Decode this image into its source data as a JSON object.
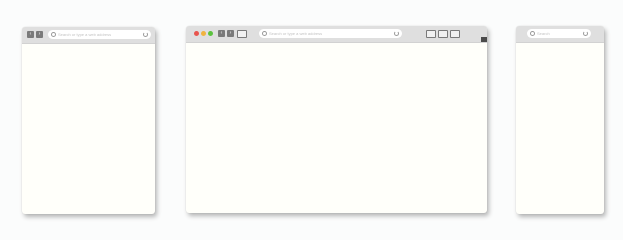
{
  "windows": {
    "tablet": {
      "back": "‹",
      "forward": "›",
      "url_placeholder": "Search or type a web address",
      "search_icon": "search-icon",
      "reload_icon": "reload-icon"
    },
    "desktop": {
      "traffic_lights": {
        "close": "#e8554e",
        "minimize": "#f0b33f",
        "maximize": "#5bc23e"
      },
      "back": "‹",
      "forward": "›",
      "url_placeholder": "Search or type a web address",
      "search_icon": "search-icon",
      "reload_icon": "reload-icon"
    },
    "mobile": {
      "back": "",
      "forward": "",
      "url_placeholder": "Search",
      "search_icon": "search-icon",
      "reload_icon": "reload-icon"
    }
  },
  "colors": {
    "page_background": "#fbfcfc",
    "window_background": "#fffffa",
    "toolbar": "#dfdfdf",
    "nav_button": "#7a7a7a"
  }
}
